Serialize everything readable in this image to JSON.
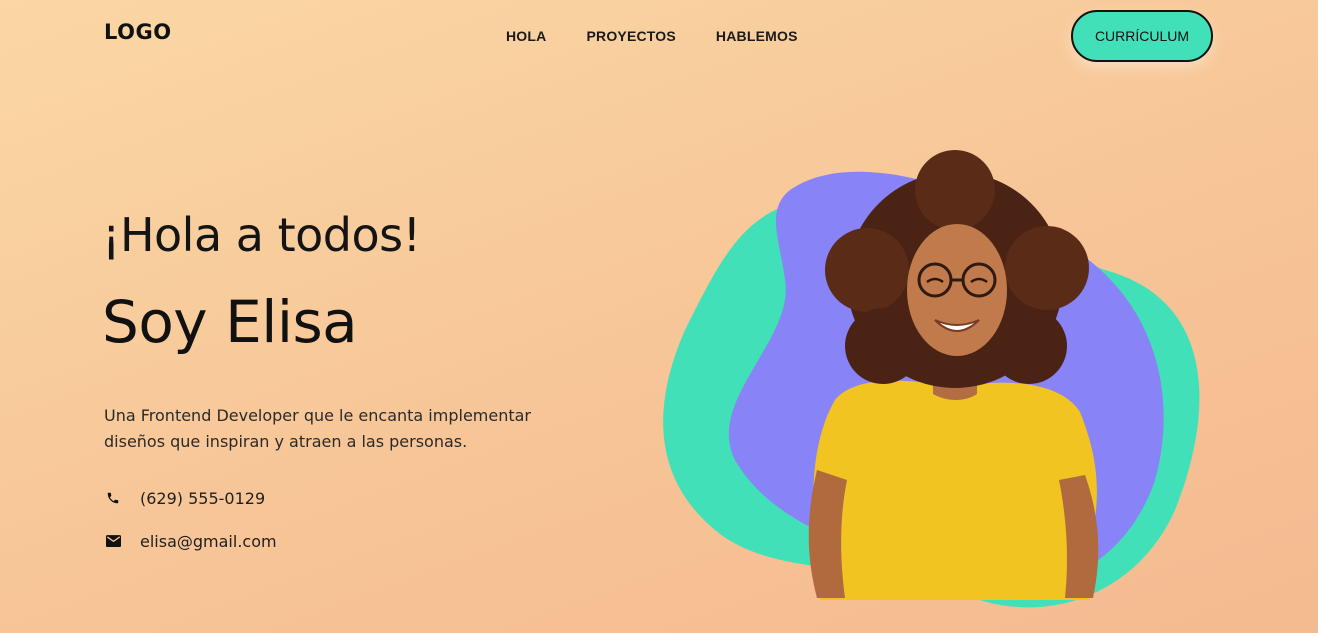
{
  "header": {
    "logo": "LOGO",
    "nav": [
      "HOLA",
      "PROYECTOS",
      "HABLEMOS"
    ],
    "cv_button": "CURRÍCULUM"
  },
  "hero": {
    "greeting": "¡Hola a todos!",
    "name": "Soy Elisa",
    "description": "Una Frontend Developer que le encanta implementar diseños que inspiran y atraen a las personas.",
    "phone": "(629) 555-0129",
    "email": "elisa@gmail.com",
    "image": "portrait of smiling woman with curly hair and glasses in yellow t-shirt"
  },
  "icons": {
    "phone": "phone-icon",
    "email": "email-icon"
  },
  "colors": {
    "accent": "#41e0b8",
    "blob_purple": "#8883f6",
    "shirt": "#f1c421"
  }
}
